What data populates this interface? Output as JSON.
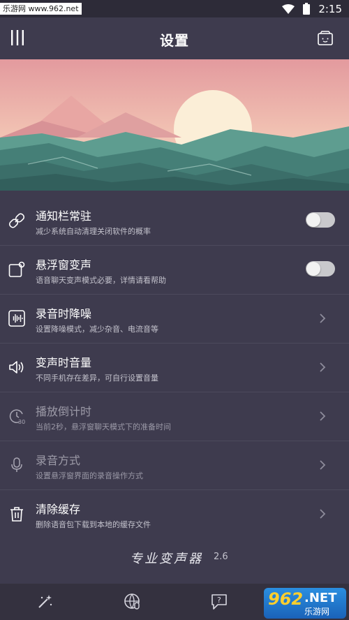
{
  "statusbar": {
    "watermark": "乐游网 www.962.net",
    "time": "2:15"
  },
  "appbar": {
    "title": "设置",
    "menu_icon": "menu-icon",
    "help_icon": "help-box-icon"
  },
  "settings": [
    {
      "title": "通知栏常驻",
      "subtitle": "减少系统自动清理关闭软件的概率",
      "icon": "link-icon",
      "control": "toggle",
      "checked": false
    },
    {
      "title": "悬浮窗变声",
      "subtitle": "语音聊天变声模式必要，详情请看帮助",
      "icon": "floating-window-icon",
      "control": "toggle",
      "checked": false
    },
    {
      "title": "录音时降噪",
      "subtitle": "设置降噪模式，减少杂音、电流音等",
      "icon": "waveform-icon",
      "control": "chevron"
    },
    {
      "title": "变声时音量",
      "subtitle": "不同手机存在差异，可自行设置音量",
      "icon": "volume-icon",
      "control": "chevron"
    },
    {
      "title": "播放倒计时",
      "subtitle": "当前2秒，悬浮窗聊天模式下的准备时间",
      "icon": "timer-icon",
      "control": "chevron",
      "dimmed": true
    },
    {
      "title": "录音方式",
      "subtitle": "设置悬浮窗界面的录音操作方式",
      "icon": "microphone-icon",
      "control": "chevron",
      "dimmed": true
    },
    {
      "title": "清除缓存",
      "subtitle": "删除语音包下载到本地的缓存文件",
      "icon": "trash-icon",
      "control": "chevron"
    }
  ],
  "footer": {
    "brand": "专业变声器",
    "version": "2.6"
  },
  "bottom_nav": [
    "magic-wand-icon",
    "voice-globe-icon",
    "help-chat-icon"
  ],
  "site_logo": {
    "number": "962",
    "suffix": ".NET",
    "name": "乐游网"
  },
  "colors": {
    "background": "#3e3b4e",
    "banner_sky": "#e8a2a2",
    "banner_sea": "#4f8f86"
  }
}
